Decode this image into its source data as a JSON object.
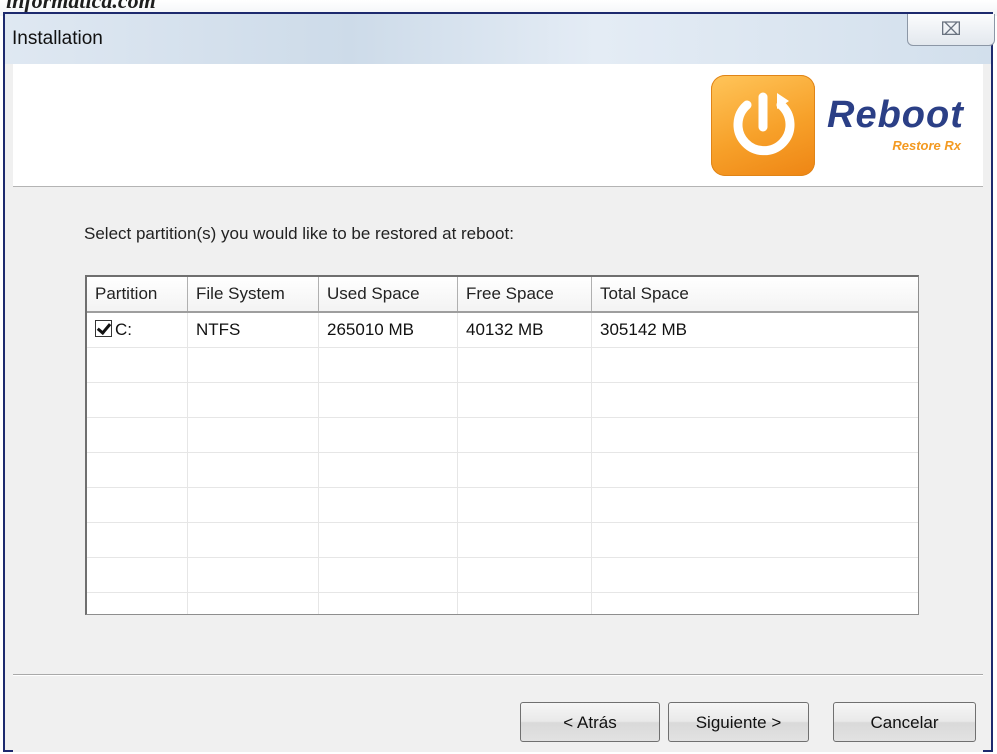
{
  "watermark": {
    "text": "informatica.com"
  },
  "window": {
    "title": "Installation",
    "close_glyph": "⌧"
  },
  "brand": {
    "name": "Reboot",
    "sub": "Restore Rx",
    "icon": "power-icon"
  },
  "prompt": "Select partition(s) you would like to be restored at reboot:",
  "table": {
    "headers": [
      "Partition",
      "File System",
      "Used Space",
      "Free Space",
      "Total Space"
    ],
    "rows": [
      {
        "checked": true,
        "partition": "C:",
        "fs": "NTFS",
        "used": "265010 MB",
        "free": "40132 MB",
        "total": "305142 MB"
      }
    ]
  },
  "buttons": {
    "back": "< Atrás",
    "next": "Siguiente >",
    "cancel": "Cancelar"
  },
  "colors": {
    "accent": "#2b3f86",
    "orange": "#f39a22",
    "window_border": "#1d2a6e"
  }
}
